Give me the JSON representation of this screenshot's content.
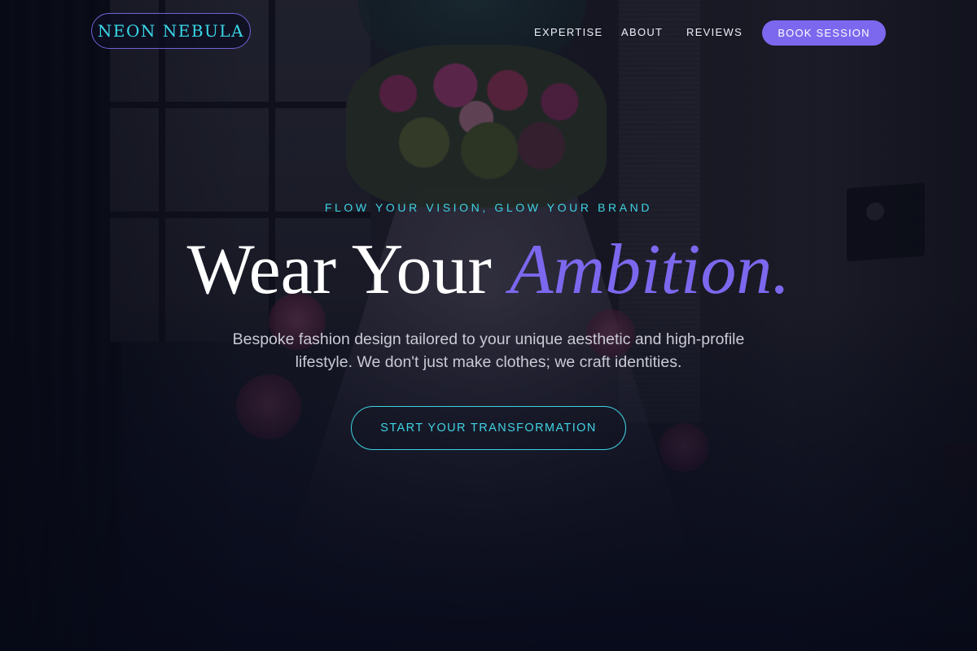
{
  "nav": {
    "logo": "NEON NEBULA",
    "links": [
      {
        "label": "EXPERTISE"
      },
      {
        "label": "ABOUT"
      },
      {
        "label": "REVIEWS"
      }
    ],
    "book_button": "BOOK SESSION"
  },
  "hero": {
    "eyebrow": "FLOW YOUR VISION, GLOW YOUR BRAND",
    "headline_plain": "Wear Your",
    "headline_accent": "Ambition.",
    "subtitle": "Bespoke fashion design tailored to your unique aesthetic and high-profile lifestyle. We don't just make clothes; we craft identities.",
    "cta": "START YOUR TRANSFORMATION"
  },
  "colors": {
    "accent_purple": "#7b68ee",
    "accent_cyan": "#3fd3e3",
    "background": "#0b0e1d",
    "text_primary": "#ffffff"
  }
}
